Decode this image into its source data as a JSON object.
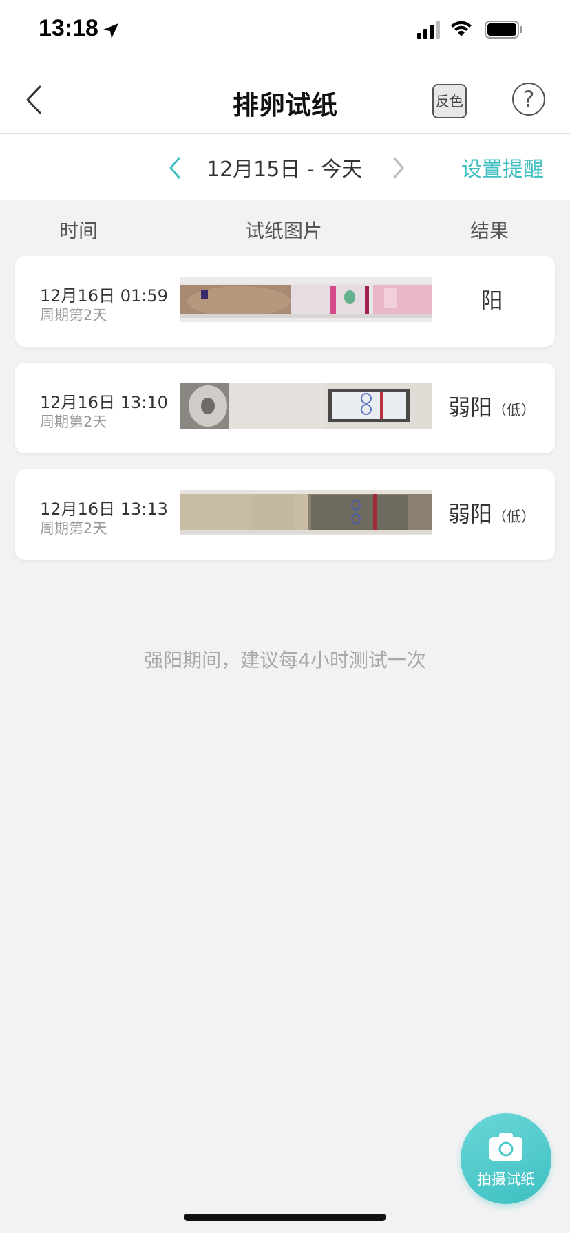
{
  "status": {
    "time": "13:18"
  },
  "nav": {
    "title": "排卵试纸",
    "invert_label": "反色",
    "help_label": "?"
  },
  "date_bar": {
    "date_range": "12月15日 - 今天",
    "reminder_label": "设置提醒"
  },
  "columns": {
    "time": "时间",
    "image": "试纸图片",
    "result": "结果"
  },
  "records": [
    {
      "time": "12月16日 01:59",
      "cycle": "周期第2天",
      "result": "阳",
      "result_note": ""
    },
    {
      "time": "12月16日 13:10",
      "cycle": "周期第2天",
      "result": "弱阳",
      "result_note": "（低）"
    },
    {
      "time": "12月16日 13:13",
      "cycle": "周期第2天",
      "result": "弱阳",
      "result_note": "（低）"
    }
  ],
  "tip": "强阳期间，建议每4小时测试一次",
  "capture": {
    "label": "拍摄试纸"
  },
  "colors": {
    "accent": "#3fbfc1",
    "background": "#f3f2f3",
    "card": "#ffffff"
  },
  "icons": [
    "location-arrow-icon",
    "signal-icon",
    "wifi-icon",
    "battery-icon",
    "back-chevron-icon",
    "question-icon",
    "chevron-left-icon",
    "chevron-right-icon",
    "camera-icon"
  ]
}
